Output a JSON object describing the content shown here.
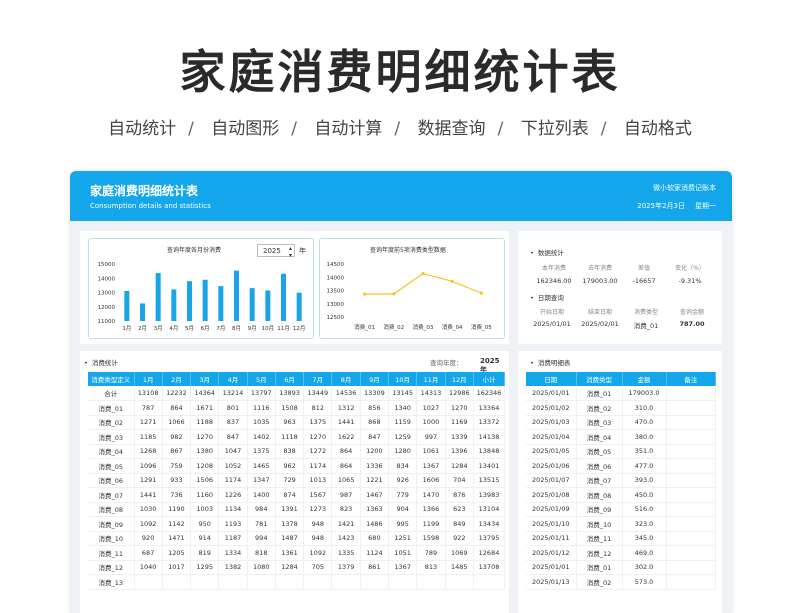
{
  "banner": {
    "title": "家庭消费明细统计表",
    "features": [
      "自动统计",
      "自动图形",
      "自动计算",
      "数据查询",
      "下拉列表",
      "自动格式"
    ]
  },
  "app": {
    "title": "家庭消费明细统计表",
    "subtitle": "Consumption details and statistics",
    "author": "微小软家消费记账本",
    "date": "2025年2月3日",
    "weekday": "星期一"
  },
  "colors": {
    "accent": "#13a6ea",
    "bar": "#1aa5e6",
    "line": "#f5c326"
  },
  "chart_data": [
    {
      "type": "bar",
      "title": "查询年度各月份消费",
      "selector": {
        "value": "2025",
        "suffix": "年"
      },
      "categories": [
        "1月",
        "2月",
        "3月",
        "4月",
        "5月",
        "6月",
        "7月",
        "8月",
        "9月",
        "10月",
        "11月",
        "12月"
      ],
      "values": [
        13108,
        12232,
        14364,
        13214,
        13797,
        13893,
        13449,
        14536,
        13309,
        13145,
        14313,
        12986
      ],
      "yticks": [
        11000,
        12000,
        13000,
        14000,
        15000
      ],
      "ylim": [
        11000,
        15000
      ]
    },
    {
      "type": "line",
      "title": "查询年度前5项消费类型数据",
      "categories": [
        "消费_01",
        "消费_02",
        "消费_03",
        "消费_04",
        "消费_05"
      ],
      "values": [
        13364,
        13372,
        14138,
        13848,
        13401
      ],
      "yticks": [
        12500,
        13000,
        13500,
        14000,
        14500
      ],
      "ylim": [
        12500,
        14500
      ]
    }
  ],
  "stats": {
    "title": "数据统计",
    "headers": [
      "本年消费",
      "去年消费",
      "差值",
      "变化（%）"
    ],
    "values": [
      "162346.00",
      "179003.00",
      "-16657",
      "-9.31%"
    ],
    "query_title": "日期查询",
    "query_headers": [
      "开始日期",
      "结束日期",
      "消费类型",
      "查询金额"
    ],
    "query_values": [
      "2025/01/01",
      "2025/02/01",
      "消费_01",
      "787.00"
    ]
  },
  "summary": {
    "title": "消费统计",
    "year_label": "查询年度：",
    "year": "2025 年",
    "headers": [
      "消费类型定义",
      "1月",
      "2月",
      "3月",
      "4月",
      "5月",
      "6月",
      "7月",
      "8月",
      "9月",
      "10月",
      "11月",
      "12月",
      "小计"
    ],
    "rows": [
      [
        "合计",
        "13108",
        "12232",
        "14364",
        "13214",
        "13797",
        "13893",
        "13449",
        "14536",
        "13309",
        "13145",
        "14313",
        "12986",
        "162346"
      ],
      [
        "消费_01",
        "787",
        "864",
        "1671",
        "801",
        "1116",
        "1508",
        "812",
        "1312",
        "856",
        "1340",
        "1027",
        "1270",
        "13364"
      ],
      [
        "消费_02",
        "1271",
        "1066",
        "1188",
        "837",
        "1035",
        "963",
        "1375",
        "1441",
        "868",
        "1159",
        "1000",
        "1169",
        "13372"
      ],
      [
        "消费_03",
        "1185",
        "982",
        "1270",
        "847",
        "1402",
        "1118",
        "1270",
        "1622",
        "847",
        "1259",
        "997",
        "1339",
        "14138"
      ],
      [
        "消费_04",
        "1268",
        "867",
        "1380",
        "1047",
        "1375",
        "838",
        "1272",
        "864",
        "1200",
        "1280",
        "1061",
        "1396",
        "13848"
      ],
      [
        "消费_05",
        "1096",
        "759",
        "1208",
        "1052",
        "1465",
        "962",
        "1174",
        "864",
        "1336",
        "834",
        "1367",
        "1284",
        "13401"
      ],
      [
        "消费_06",
        "1291",
        "933",
        "1506",
        "1174",
        "1347",
        "729",
        "1013",
        "1065",
        "1221",
        "926",
        "1606",
        "704",
        "13515"
      ],
      [
        "消费_07",
        "1441",
        "736",
        "1160",
        "1226",
        "1400",
        "874",
        "1567",
        "987",
        "1467",
        "779",
        "1470",
        "876",
        "13983"
      ],
      [
        "消费_08",
        "1030",
        "1190",
        "1003",
        "1134",
        "984",
        "1391",
        "1273",
        "823",
        "1363",
        "904",
        "1366",
        "623",
        "13104"
      ],
      [
        "消费_09",
        "1092",
        "1142",
        "950",
        "1193",
        "781",
        "1378",
        "948",
        "1421",
        "1486",
        "995",
        "1199",
        "849",
        "13434"
      ],
      [
        "消费_10",
        "920",
        "1471",
        "914",
        "1187",
        "994",
        "1487",
        "948",
        "1423",
        "680",
        "1251",
        "1598",
        "922",
        "13795"
      ],
      [
        "消费_11",
        "687",
        "1205",
        "819",
        "1334",
        "818",
        "1361",
        "1092",
        "1335",
        "1124",
        "1051",
        "789",
        "1069",
        "12684"
      ],
      [
        "消费_12",
        "1040",
        "1017",
        "1295",
        "1382",
        "1080",
        "1284",
        "705",
        "1379",
        "861",
        "1367",
        "813",
        "1485",
        "13708"
      ],
      [
        "消费_13",
        "",
        "",
        "",
        "",
        "",
        "",
        "",
        "",
        "",
        "",
        "",
        "",
        ""
      ]
    ]
  },
  "detail": {
    "title": "消费明细表",
    "headers": [
      "日期",
      "消费类型",
      "金额",
      "备注"
    ],
    "rows": [
      [
        "2025/01/01",
        "消费_01",
        "179003.0",
        ""
      ],
      [
        "2025/01/02",
        "消费_02",
        "310.0",
        ""
      ],
      [
        "2025/01/03",
        "消费_03",
        "470.0",
        ""
      ],
      [
        "2025/01/04",
        "消费_04",
        "380.0",
        ""
      ],
      [
        "2025/01/05",
        "消费_05",
        "351.0",
        ""
      ],
      [
        "2025/01/06",
        "消费_06",
        "477.0",
        ""
      ],
      [
        "2025/01/07",
        "消费_07",
        "393.0",
        ""
      ],
      [
        "2025/01/08",
        "消费_08",
        "450.0",
        ""
      ],
      [
        "2025/01/09",
        "消费_09",
        "516.0",
        ""
      ],
      [
        "2025/01/10",
        "消费_10",
        "323.0",
        ""
      ],
      [
        "2025/01/11",
        "消费_11",
        "345.0",
        ""
      ],
      [
        "2025/01/12",
        "消费_12",
        "469.0",
        ""
      ],
      [
        "2025/01/01",
        "消费_01",
        "302.0",
        ""
      ],
      [
        "2025/01/13",
        "消费_02",
        "573.0",
        ""
      ]
    ]
  }
}
